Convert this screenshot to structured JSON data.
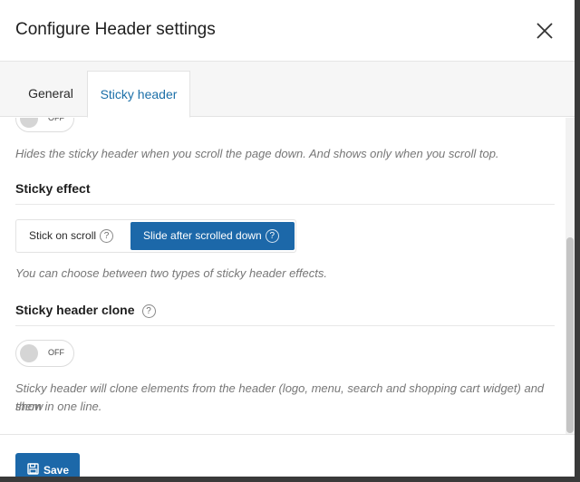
{
  "dialog": {
    "title": "Configure Header settings"
  },
  "tabs": [
    {
      "label": "General"
    },
    {
      "label": "Sticky header"
    }
  ],
  "content": {
    "toggle_hide": {
      "state": "OFF"
    },
    "hide_description": "Hides the sticky header when you scroll the page down. And shows only when you scroll top.",
    "sticky_effect": {
      "title": "Sticky effect",
      "options": [
        {
          "label": "Stick on scroll"
        },
        {
          "label": "Slide after scrolled down"
        }
      ],
      "help": "?",
      "selected": "Slide after scrolled down",
      "description": "You can choose between two types of sticky header effects."
    },
    "sticky_clone": {
      "title": "Sticky header clone",
      "help": "?",
      "toggle_state": "OFF",
      "description_line1": "Sticky header will clone elements from the header (logo, menu, search and shopping cart widget) and show",
      "description_line2": "them in one line."
    }
  },
  "footer": {
    "save_label": "Save"
  },
  "colors": {
    "accent": "#1c68a9",
    "active_tab_text": "#1b6fa8"
  },
  "icons": {
    "close": "close-icon",
    "save": "floppy-disk-icon",
    "help": "question-circle-icon"
  }
}
